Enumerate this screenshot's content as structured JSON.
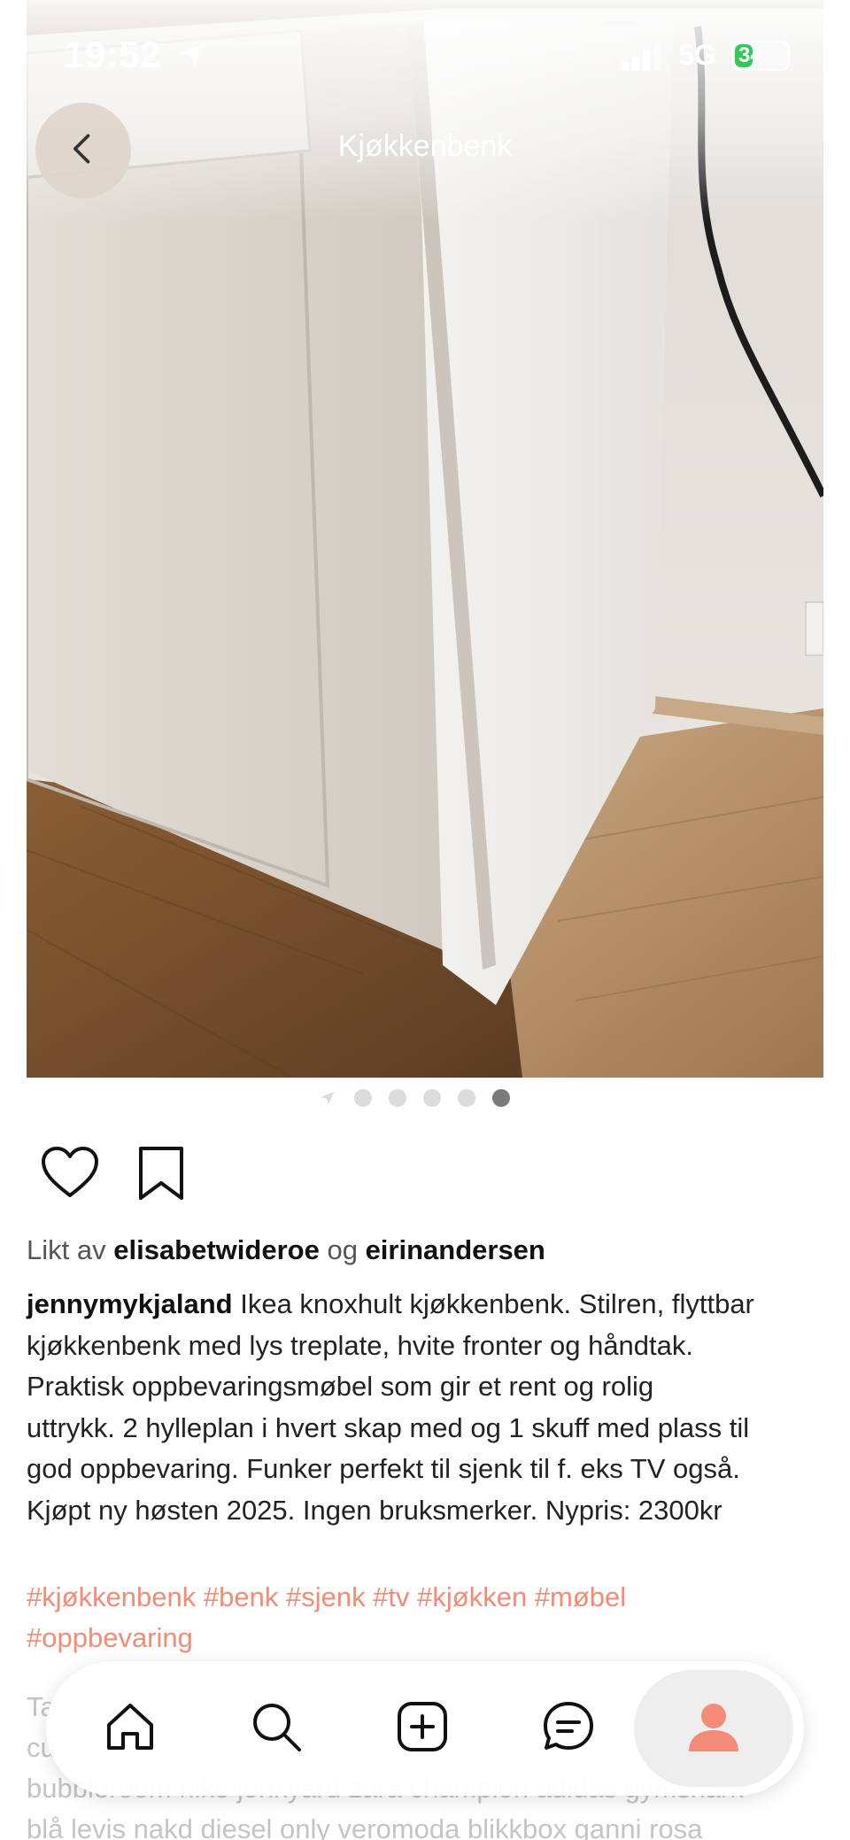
{
  "status_bar": {
    "time": "19:52",
    "network": "5G",
    "battery": "34",
    "battery_level": 0.34,
    "icons": [
      "location-arrow-icon",
      "cellular-signal-icon",
      "battery-charging-icon"
    ]
  },
  "header": {
    "title": "Kjøkkenbenk",
    "back_icon": "chevron-left-icon"
  },
  "photo": {
    "description_icon": "kitchen-cabinet-photo"
  },
  "pager": {
    "count": 5,
    "active_index": 4
  },
  "actions": {
    "like_icon": "heart-outline-icon",
    "save_icon": "bookmark-outline-icon"
  },
  "likes": {
    "prefix": "Likt av",
    "user1": "elisabetwideroe",
    "conjunction": "og",
    "user2": "eirinandersen"
  },
  "caption": {
    "username": "jennymykjaland",
    "lines": [
      "Ikea knoxhult kjøkkenbenk. Stilren, flyttbar",
      "kjøkkenbenk med lys treplate, hvite fronter og håndtak.",
      "Praktisk oppbevaringsmøbel som gir et rent og rolig",
      "uttrykk. 2 hylleplan i hvert skap med og 1 skuff med plass til",
      "god oppbevaring. Funker perfekt til sjenk til f. eks TV også.",
      "Kjøpt ny høsten 2025. Ingen bruksmerker. Nypris: 2300kr"
    ]
  },
  "hashtags": {
    "lines": [
      "#kjøkkenbenk #benk #sjenk #tv #kjøkken #møbel",
      "#oppbevaring"
    ]
  },
  "faded_tags": {
    "lines": [
      "Ta",
      "cu",
      "bubbleroom nike jonkyard zara champion adidas gymshark",
      "blå levis nakd diesel only veromoda blikkbox ganni rosa"
    ]
  },
  "bottom_nav": {
    "items": [
      {
        "name": "home",
        "icon": "home-icon"
      },
      {
        "name": "search",
        "icon": "search-icon"
      },
      {
        "name": "add",
        "icon": "plus-square-icon"
      },
      {
        "name": "messages",
        "icon": "chat-bubble-icon"
      },
      {
        "name": "profile",
        "icon": "profile-icon",
        "active": true
      }
    ],
    "accent_color": "#f28c77"
  },
  "colors": {
    "hashtag": "#f28c77",
    "active_dot": "#7a7a7a",
    "inactive_dot": "#dcdcdc",
    "battery_green": "#34c759"
  }
}
